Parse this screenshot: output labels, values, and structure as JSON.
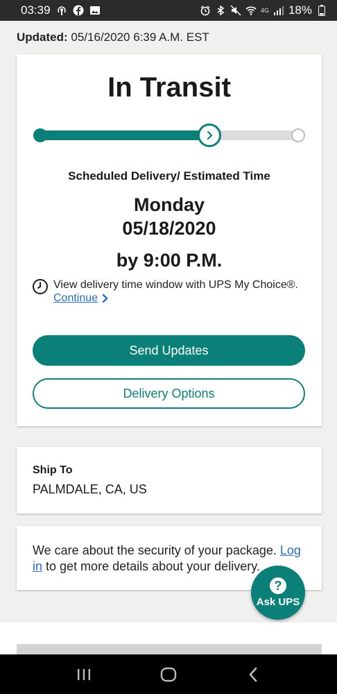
{
  "status_bar": {
    "time": "03:39",
    "network": "4G",
    "battery": "18%"
  },
  "updated": {
    "label": "Updated:",
    "value": "05/16/2020 6:39 A.M. EST"
  },
  "tracking": {
    "status": "In Transit",
    "progress_fraction": 0.66,
    "scheduled_label": "Scheduled Delivery/ Estimated Time",
    "day": "Monday",
    "date": "05/18/2020",
    "time": "by 9:00 P.M.",
    "window_text": "View delivery time window with UPS My Choice®.",
    "continue_label": "Continue",
    "send_updates_label": "Send Updates",
    "delivery_options_label": "Delivery Options"
  },
  "ship_to": {
    "label": "Ship To",
    "value": "PALMDALE, CA, US"
  },
  "security": {
    "text_before": "We care about the security of your package.",
    "login_link": "Log in",
    "text_after": "to get more details about your delivery."
  },
  "ask": {
    "icon": "?",
    "label": "Ask UPS"
  },
  "colors": {
    "accent": "#0a8078",
    "link": "#2a6fbf"
  }
}
